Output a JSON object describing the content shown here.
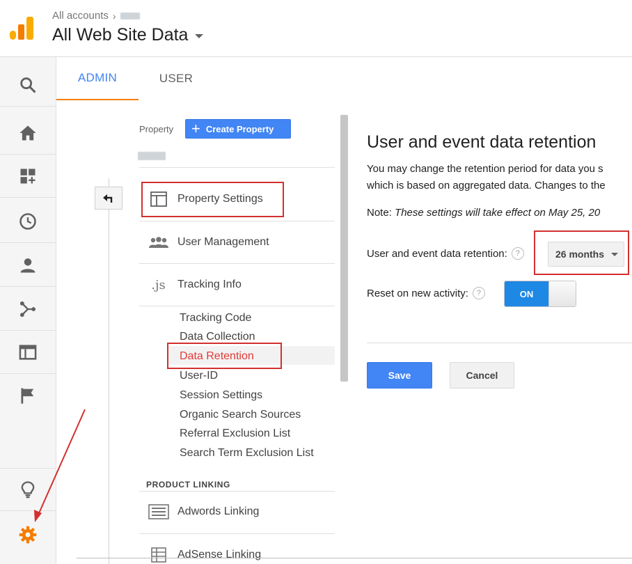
{
  "header": {
    "breadcrumb_root": "All accounts",
    "view_title": "All Web Site Data"
  },
  "tabs": [
    {
      "label": "ADMIN",
      "active": true
    },
    {
      "label": "USER",
      "active": false
    }
  ],
  "leftnav": {
    "icons": [
      "search-icon",
      "home-icon",
      "customization-icon",
      "realtime-clock-icon",
      "audience-person-icon",
      "acquisition-icon",
      "behavior-icon",
      "conversions-flag-icon",
      "lightbulb-icon",
      "admin-gear-icon"
    ],
    "active_color": "#f57c00"
  },
  "property_column": {
    "label": "Property",
    "create_button": "Create Property",
    "menu": [
      {
        "label": "Property Settings",
        "icon": "property-settings-icon"
      },
      {
        "label": "User Management",
        "icon": "users-icon"
      },
      {
        "label": "Tracking Info",
        "icon": "js-icon"
      }
    ],
    "tracking_submenu": [
      "Tracking Code",
      "Data Collection",
      "Data Retention",
      "User-ID",
      "Session Settings",
      "Organic Search Sources",
      "Referral Exclusion List",
      "Search Term Exclusion List"
    ],
    "active_submenu": "Data Retention",
    "section_product_linking": "PRODUCT LINKING",
    "linking": [
      {
        "label": "Adwords Linking",
        "icon": "adwords-linking-icon"
      },
      {
        "label": "AdSense Linking",
        "icon": "adsense-linking-icon"
      }
    ]
  },
  "content": {
    "title": "User and event data retention",
    "desc_line1": "You may change the retention period for data you s",
    "desc_line2": "which is based on aggregated data. Changes to the",
    "note_prefix": "Note: ",
    "note_text": "These settings will take effect on May 25, 20",
    "retention_label": "User and event data retention:",
    "retention_value": "26 months",
    "reset_label": "Reset on new activity:",
    "reset_state": "ON",
    "save_label": "Save",
    "cancel_label": "Cancel"
  },
  "colors": {
    "accent_blue": "#4285f4",
    "highlight_red": "#d32f2f",
    "tab_underline": "#f57c00"
  }
}
